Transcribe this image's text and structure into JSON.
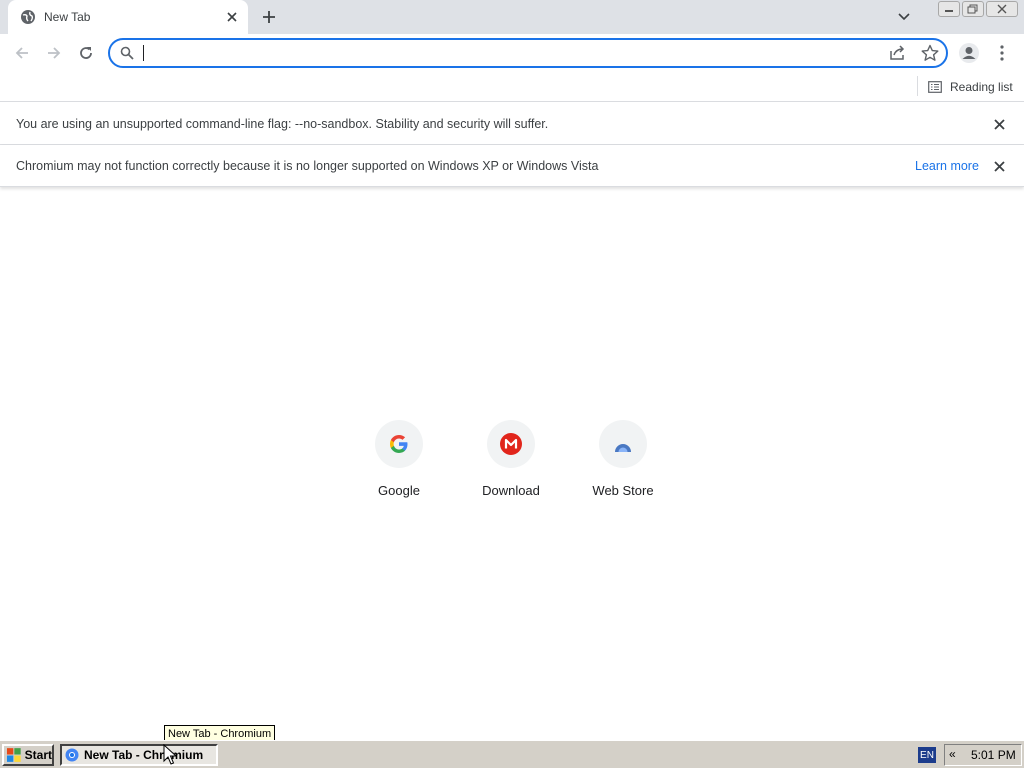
{
  "colors": {
    "accent": "#1a73e8",
    "tabstrip": "#dee1e6",
    "taskbar": "#d4d0c8",
    "download_red": "#e1251b"
  },
  "tab": {
    "title": "New Tab",
    "favicon": "globe-icon"
  },
  "toolbar": {
    "back": "back-arrow-icon",
    "forward": "forward-arrow-icon",
    "reload": "reload-icon",
    "omnibox_value": ""
  },
  "bookmarks": {
    "reading_list_label": "Reading list"
  },
  "infobars": [
    {
      "text": "You are using an unsupported command-line flag: --no-sandbox. Stability and security will suffer."
    },
    {
      "text": "Chromium may not function correctly because it is no longer supported on Windows XP or Windows Vista",
      "link": "Learn more"
    }
  ],
  "shortcuts": [
    {
      "label": "Google",
      "icon": "google-g-icon"
    },
    {
      "label": "Download",
      "icon": "mega-m-icon"
    },
    {
      "label": "Web Store",
      "icon": "web-store-icon"
    }
  ],
  "tooltip": "New Tab - Chromium",
  "taskbar": {
    "start_label": "Start",
    "task_label": "New Tab - Chromium",
    "language": "EN",
    "tray_chevron": "«",
    "clock": "5:01 PM"
  }
}
